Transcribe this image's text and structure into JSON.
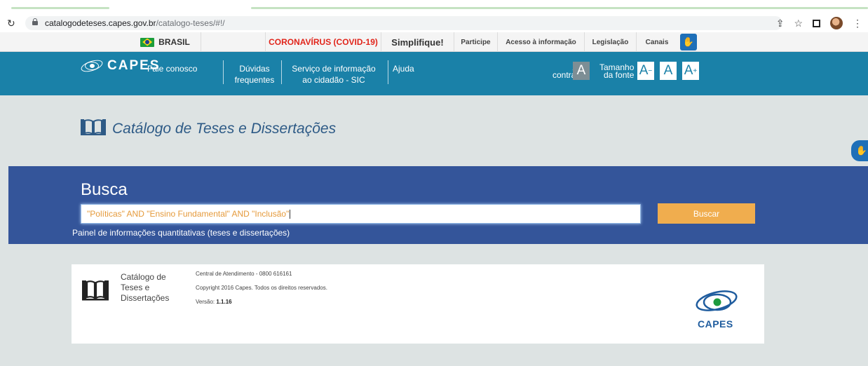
{
  "browser": {
    "url_host": "catalogodeteses.capes.gov.br",
    "url_path": "/catalogo-teses/#!/"
  },
  "govbar": {
    "brasil": "BRASIL",
    "covid": "CORONAVÍRUS (COVID-19)",
    "simplifique": "Simplifique!",
    "participe": "Participe",
    "acesso": "Acesso à informação",
    "legislacao": "Legislação",
    "canais": "Canais"
  },
  "header": {
    "logo_text": "CAPES",
    "fale": "Fale conosco",
    "duvidas_1": "Dúvidas",
    "duvidas_2": "frequentes",
    "servico_1": "Serviço de informação",
    "servico_2": "ao cidadão - SIC",
    "ajuda": "Ajuda",
    "alto_1": "Alto",
    "alto_2": "contraste",
    "alto_box": "A",
    "tam_1": "Tamanho",
    "tam_2": "da fonte",
    "a_minus": "A",
    "a_norm": "A",
    "a_plus": "A",
    "minus_sup": "−",
    "plus_sup": "+"
  },
  "title": "Catálogo de Teses e Dissertações",
  "search": {
    "heading": "Busca",
    "value": "\"Políticas\" AND \"Ensino Fundamental\" AND \"Inclusão\"",
    "button": "Buscar",
    "painel": "Painel de informações quantitativas (teses e dissertações)"
  },
  "footer": {
    "cat_1": "Catálogo de",
    "cat_2": "Teses e",
    "cat_3": "Dissertações",
    "central": "Central de Atendimento - 0800 616161",
    "copyright": "Copyright 2016 Capes. Todos os direitos reservados.",
    "versao_label": "Versão: ",
    "versao": "1.1.16",
    "capes": "CAPES"
  },
  "colors": {
    "header_blue": "#1a81a8",
    "search_blue": "#34559a",
    "button_orange": "#f0ad4e",
    "covid_red": "#e1251b"
  }
}
